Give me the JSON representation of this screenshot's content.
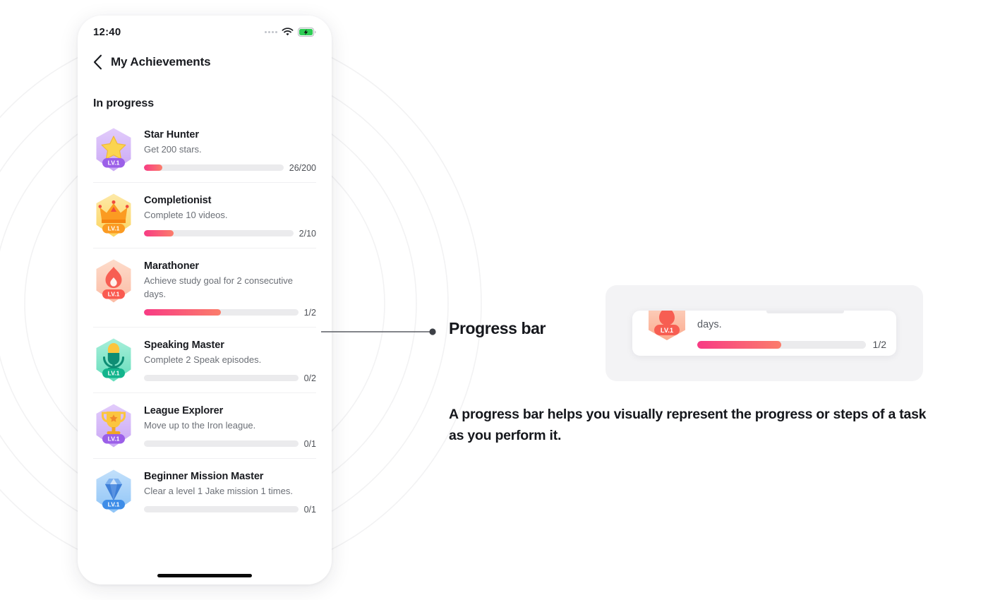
{
  "phone": {
    "status_bar": {
      "time": "12:40",
      "signal_icon": "signal-dots-icon",
      "wifi_icon": "wifi-icon",
      "battery_icon": "battery-charging-icon",
      "battery_color": "#2ECC54"
    },
    "nav": {
      "back_icon": "chevron-left-icon",
      "title": "My Achievements"
    },
    "section_title": "In progress",
    "achievements": [
      {
        "title": "Star Hunter",
        "description": "Get 200 stars.",
        "progress_label": "26/200",
        "progress_percent": 13,
        "badge_icon": "star-badge-icon",
        "level_label": "LV.1",
        "badge_color": "#C9A7F5",
        "badge_color_2": "#E2CCFB",
        "level_pill_color": "#9B5FE8"
      },
      {
        "title": "Completionist",
        "description": "Complete 10 videos.",
        "progress_label": "2/10",
        "progress_percent": 20,
        "badge_icon": "crown-badge-icon",
        "level_label": "LV.1",
        "badge_color": "#FCD45E",
        "badge_color_2": "#FDE9A8",
        "level_pill_color": "#FB9B22"
      },
      {
        "title": "Marathoner",
        "description": "Achieve study goal for 2 consecutive days.",
        "progress_label": "1/2",
        "progress_percent": 50,
        "badge_icon": "flame-badge-icon",
        "level_label": "LV.1",
        "badge_color": "#FCBBA4",
        "badge_color_2": "#FDDCCB",
        "level_pill_color": "#FA5A50"
      },
      {
        "title": "Speaking Master",
        "description": "Complete 2 Speak episodes.",
        "progress_label": "0/2",
        "progress_percent": 0,
        "badge_icon": "microphone-badge-icon",
        "level_label": "LV.1",
        "badge_color": "#63DDBB",
        "badge_color_2": "#A8EFDA",
        "level_pill_color": "#13B48C"
      },
      {
        "title": "League Explorer",
        "description": "Move up to the Iron league.",
        "progress_label": "0/1",
        "progress_percent": 0,
        "badge_icon": "trophy-badge-icon",
        "level_label": "LV.1",
        "badge_color": "#C9A7F5",
        "badge_color_2": "#E2CCFB",
        "level_pill_color": "#9B5FE8"
      },
      {
        "title": "Beginner Mission Master",
        "description": "Clear a level 1 Jake mission 1 times.",
        "progress_label": "0/1",
        "progress_percent": 0,
        "badge_icon": "diamond-badge-icon",
        "level_label": "LV.1",
        "badge_color": "#8EC4F7",
        "badge_color_2": "#C2E0FB",
        "level_pill_color": "#3E8DE8"
      }
    ],
    "home_indicator": "home-indicator"
  },
  "annotation": {
    "callout_label": "Progress bar",
    "caption": "A progress bar helps you visually represent the progress or steps of a task as you perform it."
  },
  "zoom_detail": {
    "level_label": "LV.1",
    "description_fragment": "days.",
    "progress_label": "1/2",
    "progress_percent": 50
  },
  "theme": {
    "progress_from": "#F83B84",
    "progress_to": "#FB7D6B",
    "track": "#EBEBED",
    "text_primary": "#191B20",
    "text_secondary": "#6B6F76"
  }
}
